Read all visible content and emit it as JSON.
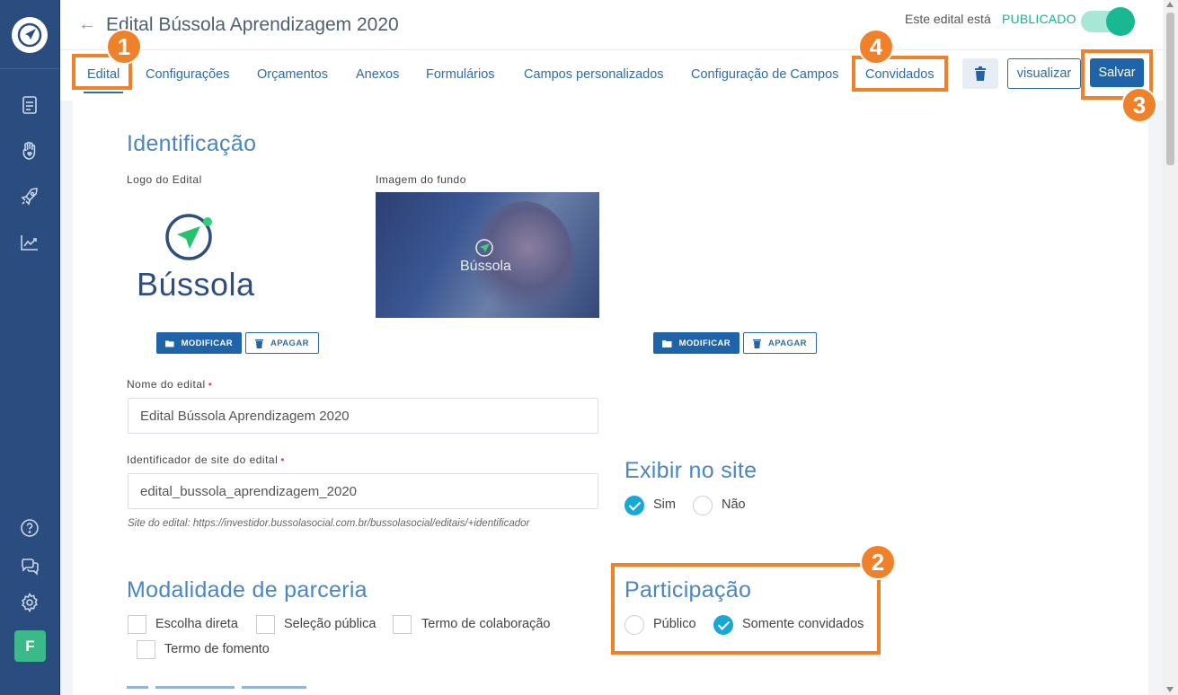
{
  "header": {
    "title": "Edital Bússola Aprendizagem 2020",
    "status_label": "Este edital está",
    "status_value": "PUBLICADO"
  },
  "tabs": [
    {
      "label": "Edital",
      "active": true
    },
    {
      "label": "Configurações"
    },
    {
      "label": "Orçamentos"
    },
    {
      "label": "Anexos"
    },
    {
      "label": "Formulários"
    },
    {
      "label": "Campos personalizados"
    },
    {
      "label": "Configuração de Campos"
    },
    {
      "label": "Convidados"
    }
  ],
  "actions": {
    "view_label": "visualizar",
    "save_label": "Salvar"
  },
  "identification": {
    "title": "Identificação",
    "logo_label": "Logo do Edital",
    "logo_text": "Bússola",
    "bg_label": "Imagem do fundo",
    "bg_overlay_text": "Bússola",
    "modify_label": "MODIFICAR",
    "delete_label": "APAGAR"
  },
  "form": {
    "name_label": "Nome do edital",
    "name_value": "Edital Bússola Aprendizagem 2020",
    "slug_label": "Identificador de site do edital",
    "slug_value": "edital_bussola_aprendizagem_2020",
    "slug_hint": "Site do edital: https://investidor.bussolasocial.com.br/bussolasocial/editais/+identificador",
    "required_mark": "•"
  },
  "exibir": {
    "title": "Exibir no site",
    "options": [
      {
        "label": "Sim",
        "checked": true
      },
      {
        "label": "Não",
        "checked": false
      }
    ]
  },
  "modalidade": {
    "title": "Modalidade de parceria",
    "options": [
      "Escolha direta",
      "Seleção pública",
      "Termo de colaboração",
      "Termo de fomento"
    ]
  },
  "participacao": {
    "title": "Participação",
    "options": [
      {
        "label": "Público",
        "checked": false
      },
      {
        "label": "Somente convidados",
        "checked": true
      }
    ]
  },
  "sidebar": {
    "avatar_letter": "F"
  },
  "annotations": [
    "1",
    "2",
    "3",
    "4"
  ],
  "colors": {
    "sidebar": "#2b4c7e",
    "accent": "#1f63a8",
    "annotation": "#f0812b",
    "published": "#17b892"
  }
}
